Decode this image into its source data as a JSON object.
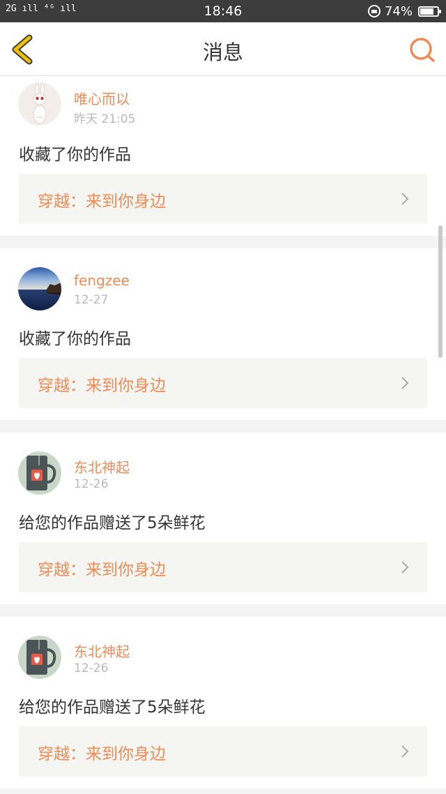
{
  "status_bar": {
    "signal": "2G ıll ⁴ᴳ ıll",
    "time": "18:46",
    "battery": "74%"
  },
  "header": {
    "title": "消息"
  },
  "notifications": [
    {
      "user": "唯心而以",
      "time": "昨天 21:05",
      "action": "收藏了你的作品",
      "work": "穿越：来到你身边"
    },
    {
      "user": "fengzee",
      "time": "12-27",
      "action": "收藏了你的作品",
      "work": "穿越：来到你身边"
    },
    {
      "user": "东北神起",
      "time": "12-26",
      "action": "给您的作品赠送了5朵鲜花",
      "work": "穿越：来到你身边"
    },
    {
      "user": "东北神起",
      "time": "12-26",
      "action": "给您的作品赠送了5朵鲜花",
      "work": "穿越：来到你身边"
    }
  ],
  "colors": {
    "accent": "#ee8a55",
    "back_arrow": "#f2c200",
    "link_bg": "#f5f5f1"
  }
}
